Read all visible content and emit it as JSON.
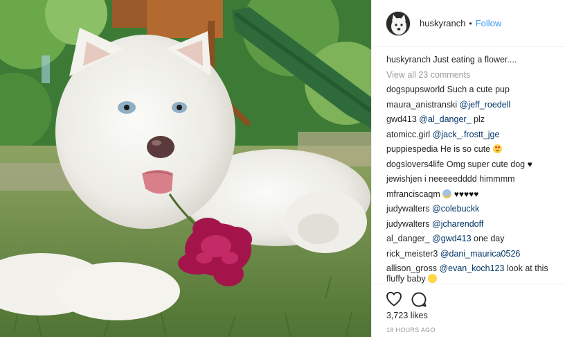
{
  "post": {
    "image_alt": "White husky puppy lying on grass with a magenta flower"
  },
  "header": {
    "username": "huskyranch",
    "separator": "•",
    "follow_label": "Follow"
  },
  "caption": {
    "username": "huskyranch",
    "text": "Just eating a flower...."
  },
  "view_all_label": "View all 23 comments",
  "comments": [
    {
      "user": "dogspupsworld",
      "text": "Such a cute pup"
    },
    {
      "user": "maura_anistranski",
      "mention": "@jeff_roedell"
    },
    {
      "user": "gwd413",
      "mention": "@al_danger_",
      "text": "plz"
    },
    {
      "user": "atomicc.girl",
      "mention": "@jack_.frostt_jge"
    },
    {
      "user": "puppiespedia",
      "text": "He is so cute"
    },
    {
      "user": "dogslovers4life",
      "text": "Omg super cute dog",
      "trailing": "♥"
    },
    {
      "user": "jewishjen",
      "text": "i neeeeedddd himmmm"
    },
    {
      "user": "mfranciscaqm",
      "trailing": "♥♥♥♥♥"
    },
    {
      "user": "judywalters",
      "mention": "@colebuckk"
    },
    {
      "user": "judywalters",
      "mention": "@jcharendoff"
    },
    {
      "user": "al_danger_",
      "mention": "@gwd413",
      "text": "one day"
    },
    {
      "user": "rick_meister3",
      "mention": "@dani_maurica0526"
    },
    {
      "user": "allison_gross",
      "mention": "@evan_koch123",
      "text": "look at this fluffy baby"
    }
  ],
  "likes": "3,723 likes",
  "time": "18 HOURS AGO",
  "icons": {
    "like": "heart-outline-icon",
    "comment": "speech-bubble-icon"
  },
  "colors": {
    "follow": "#3897f0",
    "mention": "#003569",
    "muted": "#999999",
    "border": "#efefef"
  }
}
